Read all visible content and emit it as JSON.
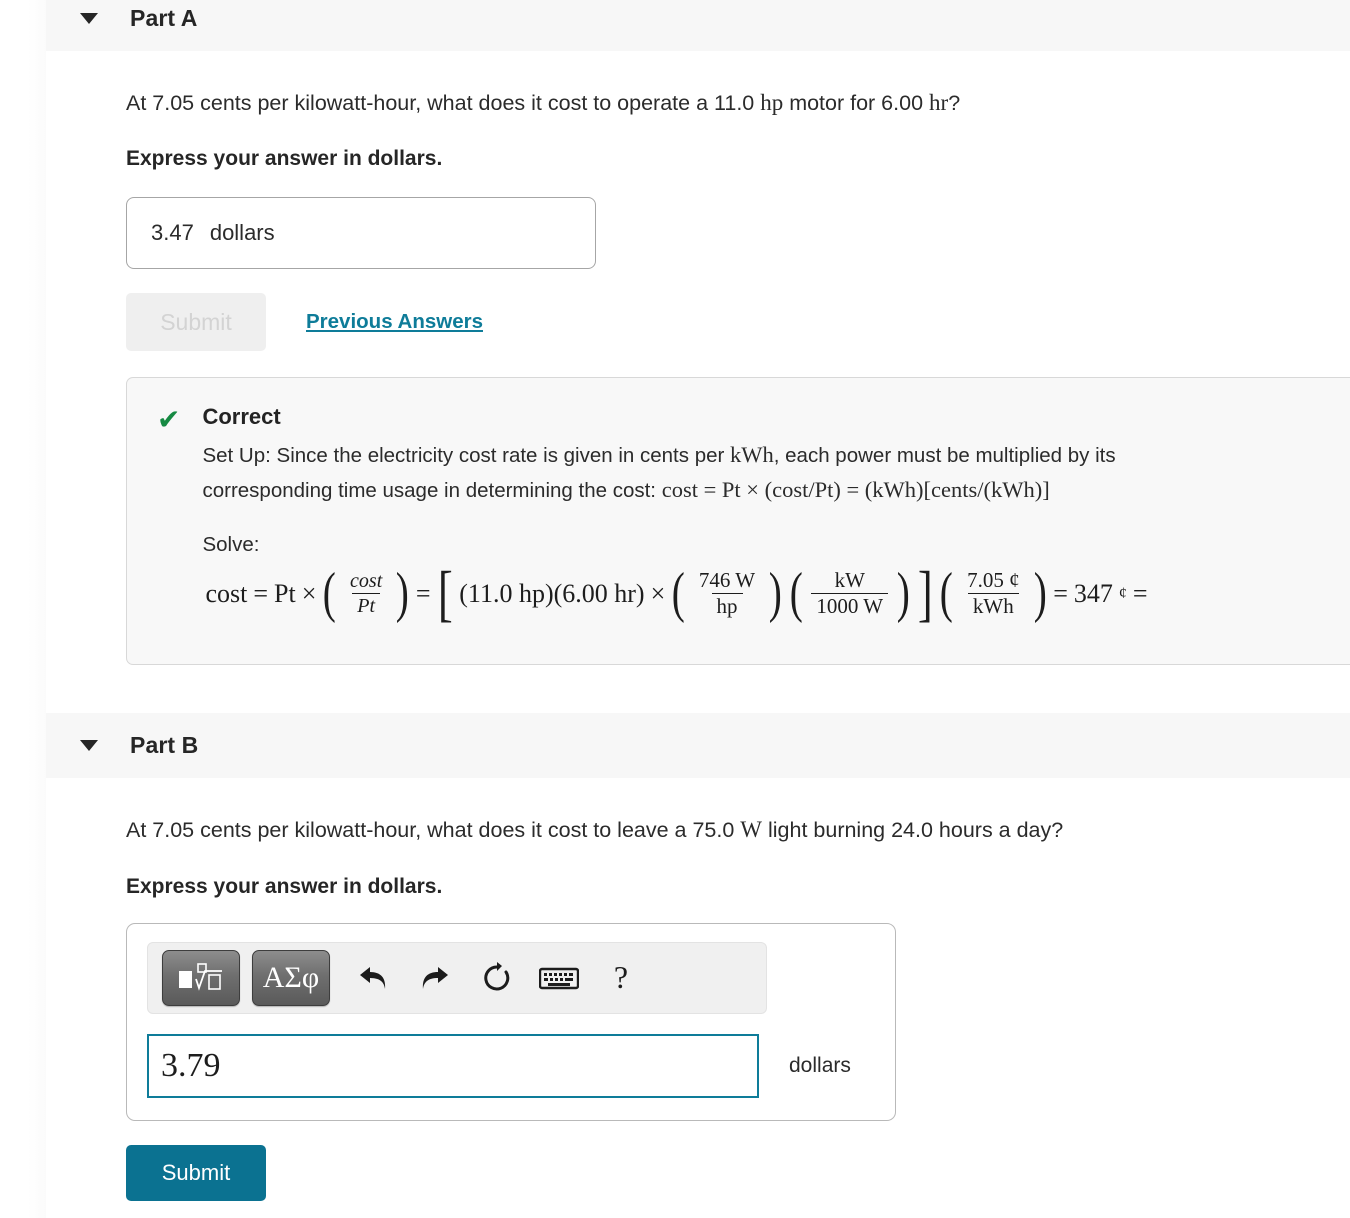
{
  "part_a": {
    "title": "Part A",
    "toggle_icon": "chevron-down-icon",
    "question": {
      "pre": "At 7.05 cents per kilowatt-hour, what does it cost to operate a 11.0 ",
      "unit1": "hp",
      "mid": " motor for 6.00 ",
      "unit2": "hr",
      "post": "?"
    },
    "express_instruction": "Express your answer in dollars.",
    "answer_value": "3.47",
    "answer_units": "dollars",
    "submit_label": "Submit",
    "previous_answers_label": "Previous Answers",
    "feedback": {
      "status_icon": "check-icon",
      "status_color": "#168a43",
      "title": "Correct",
      "line1_a": "Set Up: Since the electricity cost rate is given in cents per ",
      "line1_math": "kWh",
      "line1_b": ", each power must be multiplied by its",
      "line2_a": "corresponding time usage in determining the cost: ",
      "line2_math": "cost = Pt × (cost/Pt) = (kWh)[cents/(kWh)]",
      "solve_label": "Solve:",
      "equation": {
        "lhs": "cost",
        "eq1": "=",
        "pt": "Pt",
        "times1": "×",
        "frac1_num": "cost",
        "frac1_den": "Pt",
        "eq2": "=",
        "bracket_open": "[",
        "term1": "(11.0 hp)(6.00 hr)",
        "times2": "×",
        "frac2_num": "746 W",
        "frac2_den": "hp",
        "frac3_num": "kW",
        "frac3_den": "1000 W",
        "bracket_close": "]",
        "frac4_num": "7.05 ¢",
        "frac4_den": "kWh",
        "eq3": "=",
        "result": "347",
        "result_unit": "¢",
        "eq4": "="
      }
    }
  },
  "part_b": {
    "title": "Part B",
    "toggle_icon": "chevron-down-icon",
    "question": {
      "pre": "At 7.05 cents per kilowatt-hour, what does it cost to leave a 75.0 ",
      "unit1": "W",
      "post": " light burning 24.0 hours a day?"
    },
    "express_instruction": "Express your answer in dollars.",
    "toolbar": {
      "template_button_icon": "math-template-icon",
      "greek_button_label": "ΑΣφ",
      "undo_icon": "undo-arrow-icon",
      "redo_icon": "redo-arrow-icon",
      "reset_icon": "reset-circular-arrow-icon",
      "keyboard_icon": "keyboard-icon",
      "help_label": "?"
    },
    "answer_value": "3.79",
    "answer_units": "dollars",
    "submit_label": "Submit"
  },
  "colors": {
    "accent_teal": "#0b7291",
    "link_teal": "#0e7c99",
    "correct_green": "#168a43",
    "header_band": "#f7f7f7",
    "feedback_bg": "#f8f8f8"
  }
}
